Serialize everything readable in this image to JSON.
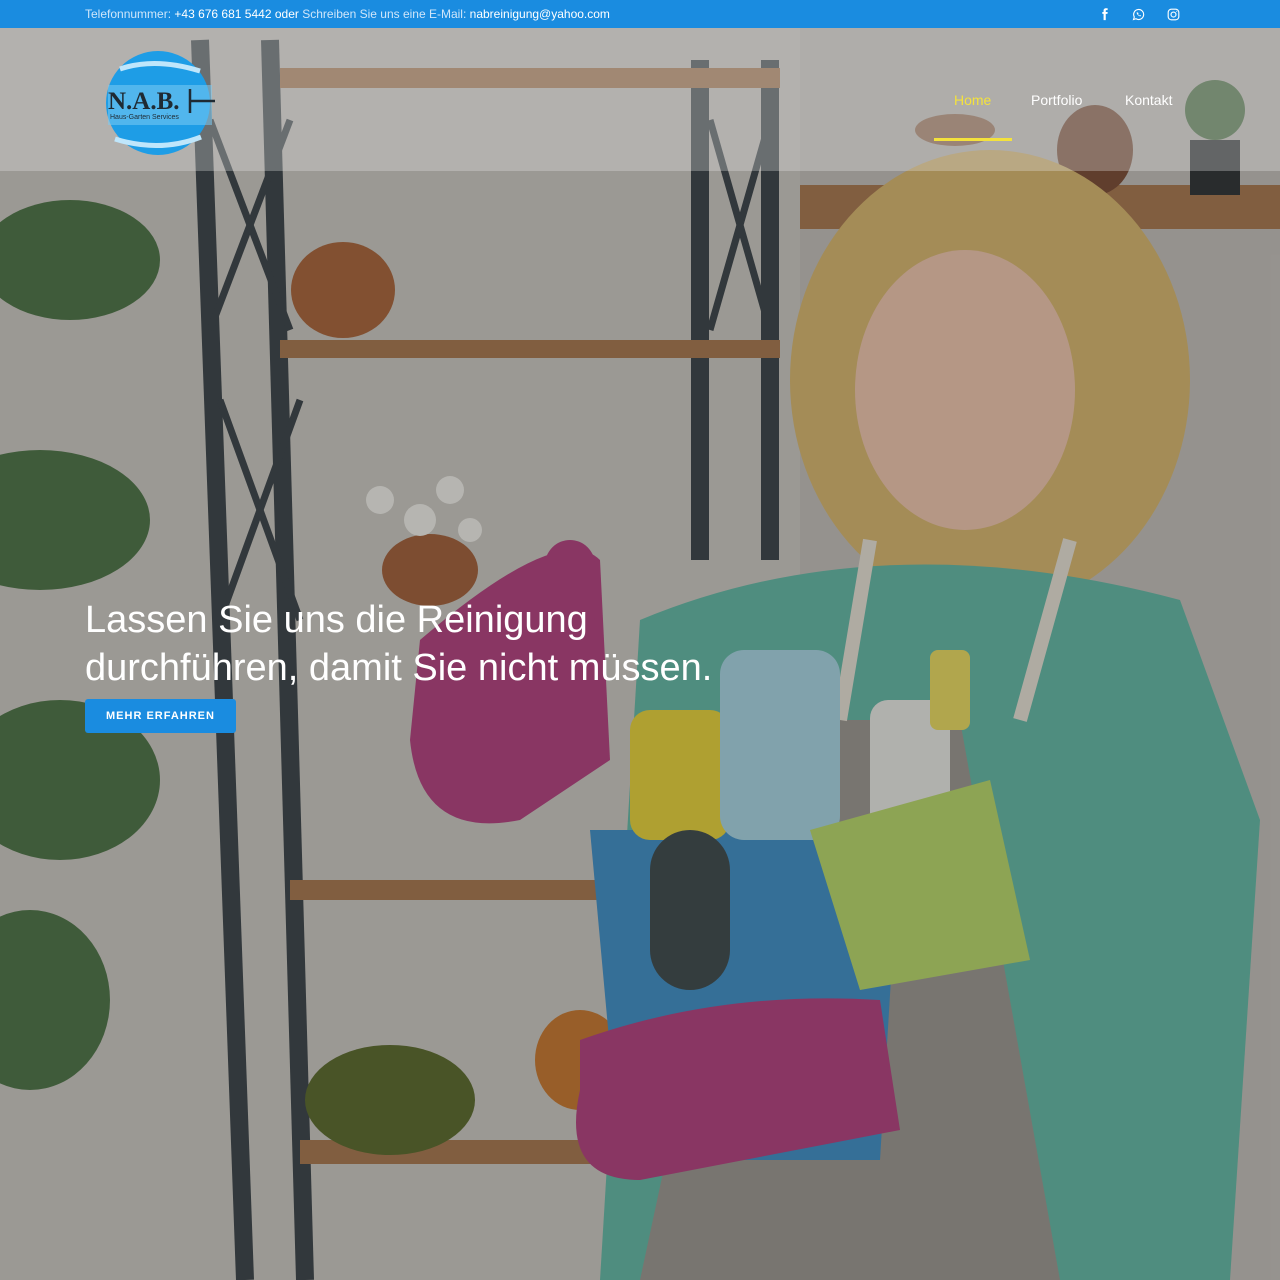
{
  "topbar": {
    "phone_label": "Telefonnummer:",
    "phone": "+43 676 681 5442",
    "or": "oder",
    "email_label": "Schreiben Sie uns eine E-Mail:",
    "email": "nabreinigung@yahoo.com",
    "social": [
      "facebook-icon",
      "whatsapp-icon",
      "instagram-icon"
    ]
  },
  "logo": {
    "text": "N.A.B.",
    "subtitle": "Haus-Garten Services"
  },
  "nav": {
    "items": [
      {
        "label": "Home",
        "active": true
      },
      {
        "label": "Portfolio",
        "active": false
      },
      {
        "label": "Kontakt",
        "active": false
      }
    ]
  },
  "hero": {
    "title_line1": "Lassen Sie uns die Reinigung",
    "title_line2": "durchführen, damit Sie nicht müssen.",
    "button": "MEHR ERFAHREN"
  },
  "colors": {
    "accent": "#1a8ce0",
    "active_nav": "#f4e23c"
  }
}
